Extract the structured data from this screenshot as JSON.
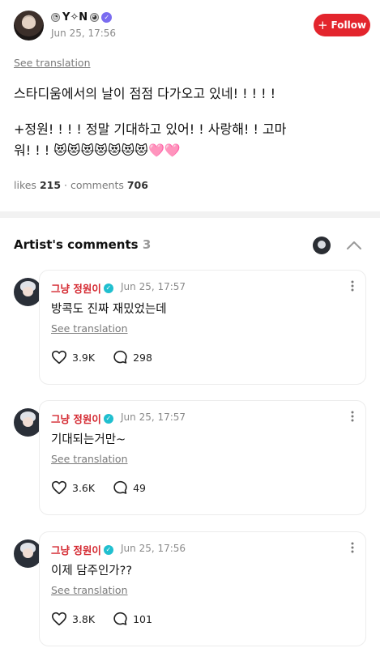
{
  "post": {
    "author": "Y✧N",
    "time": "Jun 25, 17:56",
    "follow_label": "Follow",
    "see_translation": "See translation",
    "body_line1": "스타디움에서의 날이 점점 다가오고 있네! ! ! ! !",
    "body_line2": "+정원! ! ! ! 정말 기대하고 있어! ! 사랑해! ! 고마",
    "body_line3": "워! ! ! 😻😻😻😻😻😻😻🩷🩷",
    "likes_label": "likes",
    "likes": "215",
    "comments_label": "comments",
    "comments": "706"
  },
  "artist_comments": {
    "title": "Artist's comments",
    "count": "3",
    "items": [
      {
        "name": "그냥 정원이",
        "time": "Jun 25, 17:57",
        "text": "방콕도 진짜 재밌었는데",
        "see_translation": "See translation",
        "likes": "3.9K",
        "replies": "298"
      },
      {
        "name": "그냥 정원이",
        "time": "Jun 25, 17:57",
        "text": "기대되는거만~",
        "see_translation": "See translation",
        "likes": "3.6K",
        "replies": "49"
      },
      {
        "name": "그냥 정원이",
        "time": "Jun 25, 17:56",
        "text": "이제 담주인가??",
        "see_translation": "See translation",
        "likes": "3.8K",
        "replies": "101"
      }
    ]
  },
  "icons": {
    "follow": "plus-icon",
    "verified": "verified-badge-icon",
    "more": "more-vertical-icon",
    "like": "heart-icon",
    "reply": "comment-bubble-icon",
    "collapse": "chevron-up-icon"
  },
  "colors": {
    "accent": "#e3252d",
    "artist_name": "#d4272f",
    "verified_badge": "#20bfcf",
    "muted_text": "#8a8a8a"
  }
}
